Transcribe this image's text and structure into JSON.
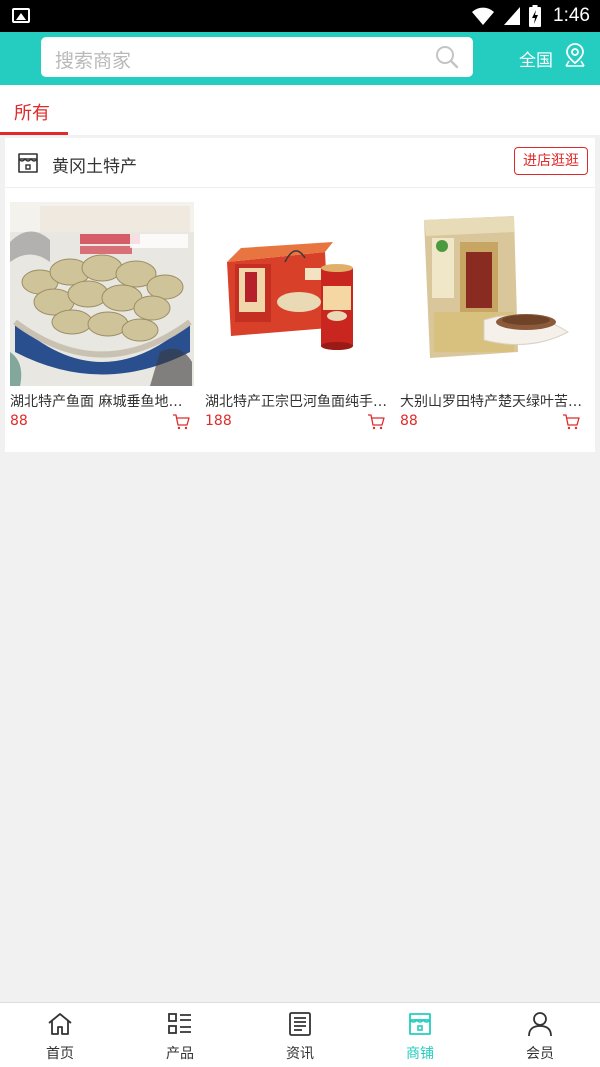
{
  "status_bar": {
    "time": "1:46"
  },
  "search": {
    "placeholder": "搜索商家"
  },
  "header": {
    "region": "全国"
  },
  "tabs": [
    {
      "label": "所有",
      "active": true
    }
  ],
  "shop": {
    "name": "黄冈土特产",
    "visit_label": "进店逛逛",
    "products": [
      {
        "title": "湖北特产鱼面 麻城垂鱼地方土特产",
        "price": "88",
        "image": "fish-noodle-bowl"
      },
      {
        "title": "湖北特产正宗巴河鱼面纯手工制作",
        "price": "188",
        "image": "fish-noodle-gift-box"
      },
      {
        "title": "大别山罗田特产楚天绿叶苦荞茶",
        "price": "88",
        "image": "buckwheat-tea-bag"
      }
    ]
  },
  "bottom_nav": [
    {
      "label": "首页",
      "icon": "home-icon",
      "active": false
    },
    {
      "label": "产品",
      "icon": "list-icon",
      "active": false
    },
    {
      "label": "资讯",
      "icon": "news-icon",
      "active": false
    },
    {
      "label": "商铺",
      "icon": "store-icon",
      "active": true
    },
    {
      "label": "会员",
      "icon": "user-icon",
      "active": false
    }
  ],
  "colors": {
    "accent": "#25cdc0",
    "price": "#e02a2a",
    "background": "#f1f1f1"
  }
}
